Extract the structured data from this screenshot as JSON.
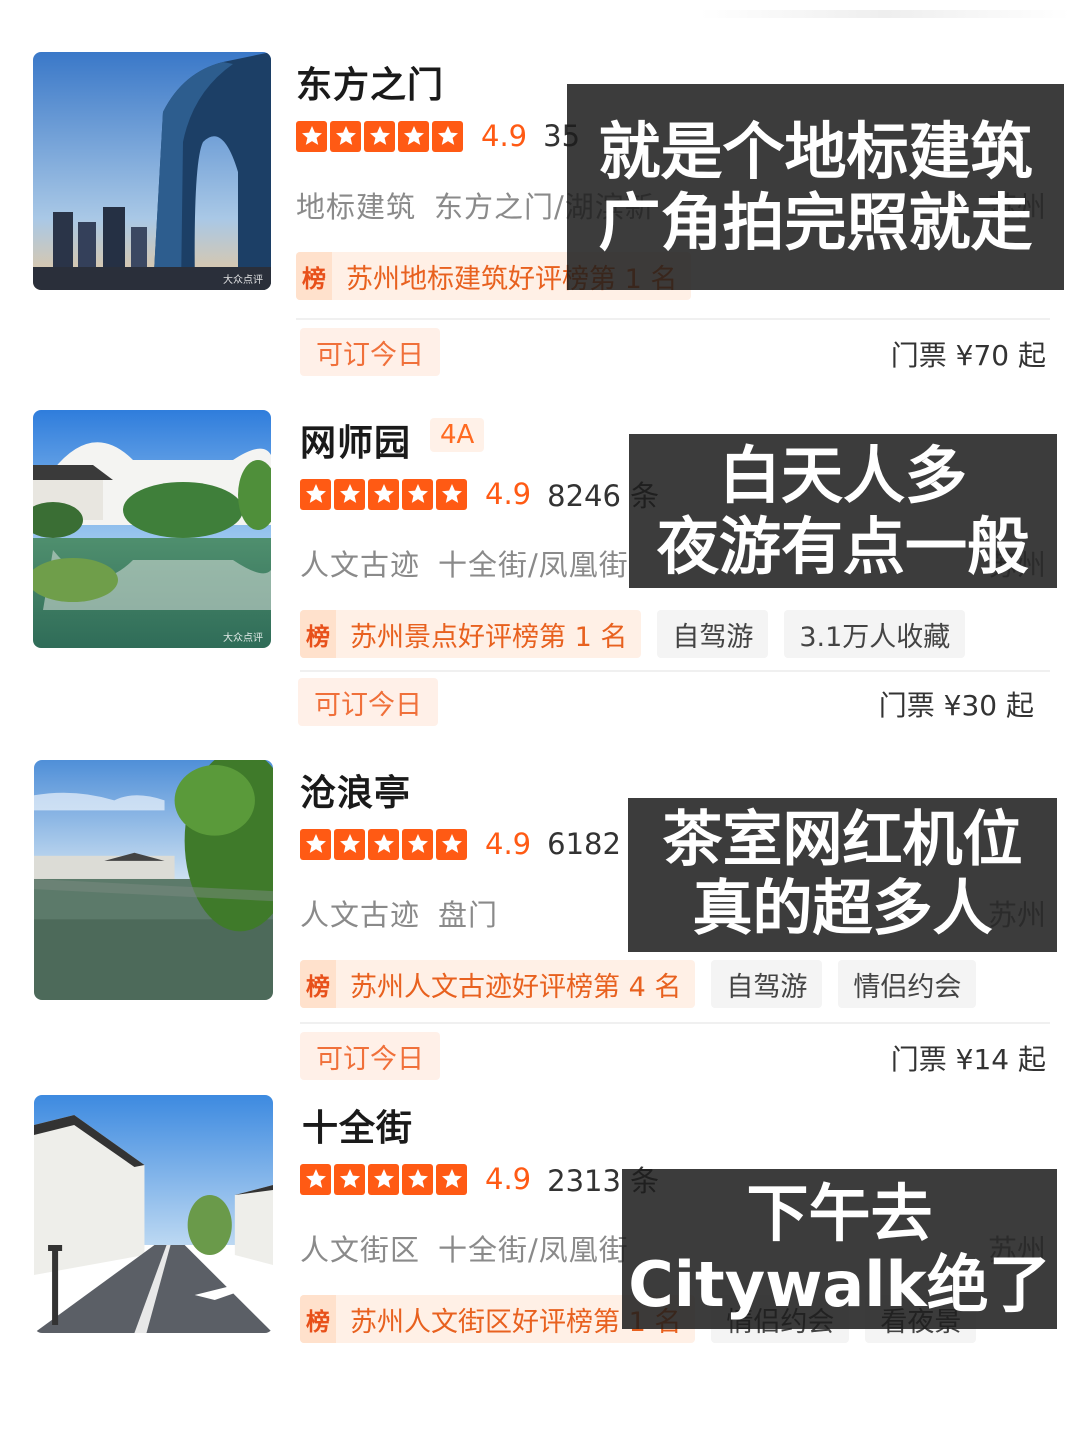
{
  "accent_color": "#ff5a14",
  "cards": [
    {
      "title": "东方之门",
      "level": "",
      "score": "4.9",
      "count": "35",
      "tags_category": "地标建筑",
      "tags_area": "东方之门/湖滨新",
      "city": "苏州",
      "rank_icon": "榜",
      "rank_text": "苏州地标建筑好评榜第 1 名",
      "extra_tags": [],
      "book_label": "可订今日",
      "price": "门票 ¥70 起",
      "overlay": [
        "就是个地标建筑",
        "广角拍完照就走"
      ]
    },
    {
      "title": "网师园",
      "level": "4A",
      "score": "4.9",
      "count": "8246 条",
      "tags_category": "人文古迹",
      "tags_area": "十全街/凤凰街",
      "city": "苏州",
      "rank_icon": "榜",
      "rank_text": "苏州景点好评榜第 1 名",
      "extra_tags": [
        "自驾游",
        "3.1万人收藏"
      ],
      "book_label": "可订今日",
      "price": "门票 ¥30 起",
      "overlay": [
        "白天人多",
        "夜游有点一般"
      ]
    },
    {
      "title": "沧浪亭",
      "level": "",
      "score": "4.9",
      "count": "6182",
      "tags_category": "人文古迹",
      "tags_area": "盘门",
      "city": "苏州",
      "rank_icon": "榜",
      "rank_text": "苏州人文古迹好评榜第 4 名",
      "extra_tags": [
        "自驾游",
        "情侣约会"
      ],
      "book_label": "可订今日",
      "price": "门票 ¥14 起",
      "overlay": [
        "茶室网红机位",
        "真的超多人"
      ]
    },
    {
      "title": "十全街",
      "level": "",
      "score": "4.9",
      "count": "2313 条",
      "tags_category": "人文街区",
      "tags_area": "十全街/凤凰街",
      "city": "苏州",
      "rank_icon": "榜",
      "rank_text": "苏州人文街区好评榜第 1 名",
      "extra_tags": [
        "情侣约会",
        "看夜景"
      ],
      "book_label": "",
      "price": "",
      "overlay": [
        "下午去",
        "Citywalk绝了"
      ]
    }
  ],
  "watermark": "大众点评"
}
